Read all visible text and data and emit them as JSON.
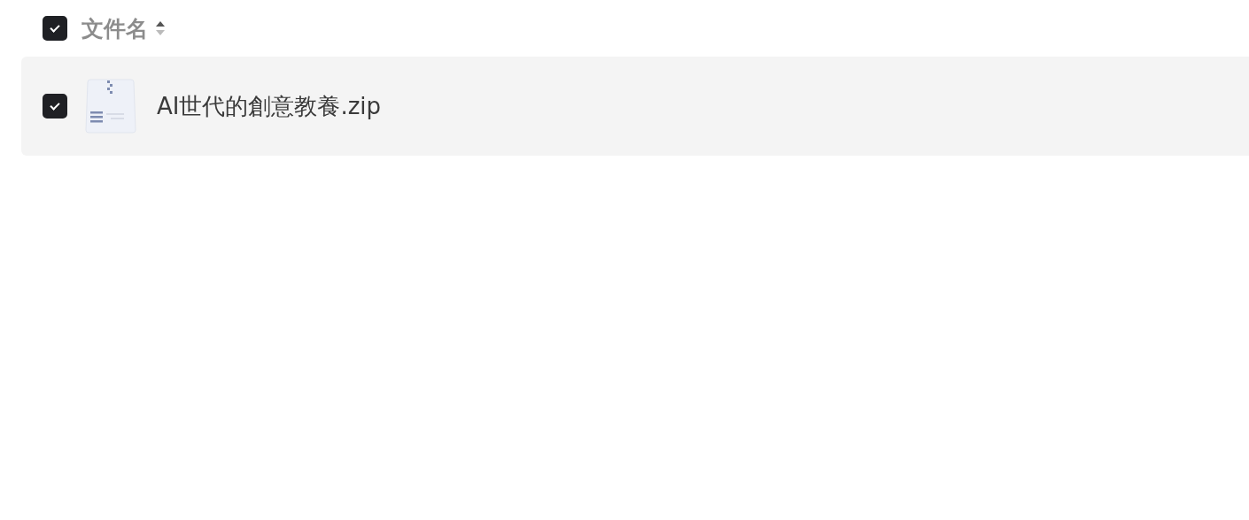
{
  "header": {
    "label": "文件名",
    "checked": true
  },
  "files": [
    {
      "name": "AI世代的創意教養.zip",
      "kind": "zip",
      "checked": true
    }
  ]
}
